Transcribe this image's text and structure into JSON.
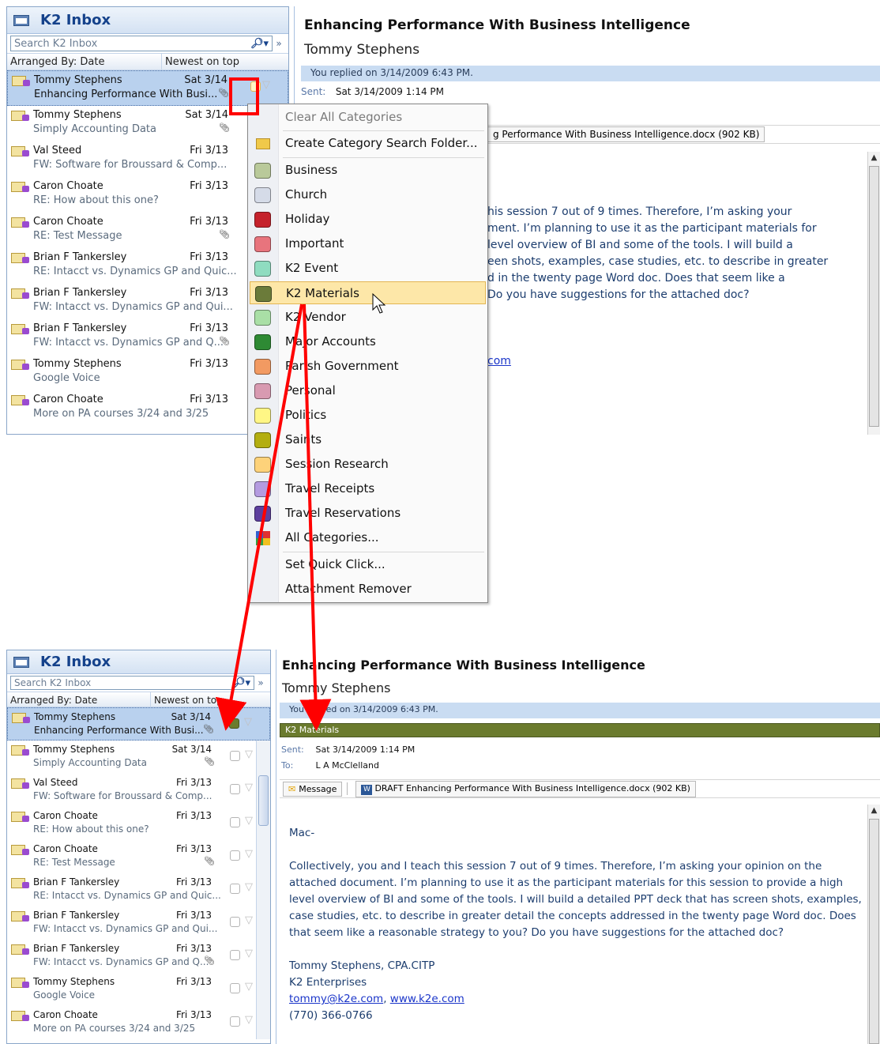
{
  "top": {
    "folder_title": "K2 Inbox",
    "search_placeholder": "Search K2 Inbox",
    "arranged_by": "Arranged By: Date",
    "sort_order": "Newest on top",
    "messages": [
      {
        "from": "Tommy Stephens",
        "date": "Sat 3/14",
        "subject": "Enhancing Performance With Busi...",
        "attachment": true
      },
      {
        "from": "Tommy Stephens",
        "date": "Sat 3/14",
        "subject": "Simply Accounting Data",
        "attachment": true
      },
      {
        "from": "Val Steed",
        "date": "Fri 3/13",
        "subject": "FW: Software for Broussard & Comp...",
        "attachment": false
      },
      {
        "from": "Caron Choate",
        "date": "Fri 3/13",
        "subject": "RE: How about this one?",
        "attachment": false
      },
      {
        "from": "Caron Choate",
        "date": "Fri 3/13",
        "subject": "RE: Test Message",
        "attachment": true
      },
      {
        "from": "Brian F Tankersley",
        "date": "Fri 3/13",
        "subject": "RE: Intacct vs. Dynamics GP and Quic...",
        "attachment": false
      },
      {
        "from": "Brian F Tankersley",
        "date": "Fri 3/13",
        "subject": "FW: Intacct vs. Dynamics GP and Qui...",
        "attachment": false
      },
      {
        "from": "Brian F Tankersley",
        "date": "Fri 3/13",
        "subject": "FW: Intacct vs. Dynamics GP and Q...",
        "attachment": true
      },
      {
        "from": "Tommy Stephens",
        "date": "Fri 3/13",
        "subject": "Google Voice",
        "attachment": false
      },
      {
        "from": "Caron Choate",
        "date": "Fri 3/13",
        "subject": "More on PA courses 3/24 and 3/25",
        "attachment": false
      }
    ],
    "reading": {
      "subject": "Enhancing Performance With Business Intelligence",
      "sender": "Tommy Stephens",
      "info": "You replied on 3/14/2009 6:43 PM.",
      "sent_label": "Sent:",
      "sent": "Sat 3/14/2009 1:14 PM",
      "attachment_partial": "g Performance With Business Intelligence.docx (902 KB)",
      "body_lines": [
        "his session 7 out of 9 times. Therefore, I’m asking your",
        "ment. I’m planning to use it as the participant materials for",
        "level overview of BI and some of the tools. I will build a",
        "een shots, examples, case studies, etc. to describe in greater",
        "d in the twenty page Word doc. Does that seem like a",
        "Do you have suggestions for the attached doc?"
      ],
      "link_partial": "com"
    }
  },
  "menu": {
    "items": [
      {
        "label": "Clear All Categories",
        "disabled": true,
        "color": null
      },
      {
        "label": "Create Category Search Folder...",
        "disabled": false,
        "icon": "search-folder-icon"
      },
      {
        "label": "Business",
        "color": "#b9c99a"
      },
      {
        "label": "Church",
        "color": "#d5dbe8"
      },
      {
        "label": "Holiday",
        "color": "#c5222c"
      },
      {
        "label": "Important",
        "color": "#e8747d"
      },
      {
        "label": "K2 Event",
        "color": "#8fdcc0"
      },
      {
        "label": "K2 Materials",
        "color": "#6b7b3a",
        "highlighted": true
      },
      {
        "label": "K2 Vendor",
        "color": "#a9dfa6"
      },
      {
        "label": "Major Accounts",
        "color": "#2e8a34"
      },
      {
        "label": "Parish Government",
        "color": "#f29a62"
      },
      {
        "label": "Personal",
        "color": "#d89ab1"
      },
      {
        "label": "Politics",
        "color": "#fff685"
      },
      {
        "label": "Saints",
        "color": "#b3ae10"
      },
      {
        "label": "Session Research",
        "color": "#fdd27a"
      },
      {
        "label": "Travel Receipts",
        "color": "#b49be0"
      },
      {
        "label": "Travel Reservations",
        "color": "#5d3f9e"
      },
      {
        "label": "All Categories...",
        "icon": "all-categories-icon"
      },
      {
        "label": "Set Quick Click..."
      },
      {
        "label": "Attachment Remover"
      }
    ]
  },
  "bottom": {
    "folder_title": "K2 Inbox",
    "search_placeholder": "Search K2 Inbox",
    "arranged_by": "Arranged By: Date",
    "sort_order": "Newest on top",
    "reading": {
      "subject": "Enhancing Performance With Business Intelligence",
      "sender": "Tommy Stephens",
      "info": "You replied on 3/14/2009 6:43 PM.",
      "category": "K2 Materials",
      "sent_label": "Sent:",
      "sent": "Sat 3/14/2009 1:14 PM",
      "to_label": "To:",
      "to": "L A McClelland",
      "message_tab": "Message",
      "attachment": "DRAFT Enhancing Performance With Business Intelligence.docx (902 KB)",
      "greeting": "Mac-",
      "paragraph": "Collectively, you and I teach this session 7 out of 9 times. Therefore, I’m asking your opinion on the attached document. I’m planning to use it as the participant materials for this session to provide a high level overview of BI and some of the tools. I will build a detailed PPT deck that has screen shots, examples, case studies, etc. to describe in greater detail the concepts addressed in the twenty page Word doc. Does that seem like a reasonable strategy to you? Do you have suggestions for the attached doc?",
      "sig_name": "Tommy Stephens, CPA.CITP",
      "sig_company": "K2 Enterprises",
      "sig_email": "tommy@k2e.com",
      "sig_sep": ", ",
      "sig_web": "www.k2e.com",
      "sig_phone": "(770) 366-0766"
    }
  },
  "colors": {
    "k2_materials": "#6b7b2e",
    "annotation_red": "#ff0000",
    "selection": "#b9d1ee"
  }
}
